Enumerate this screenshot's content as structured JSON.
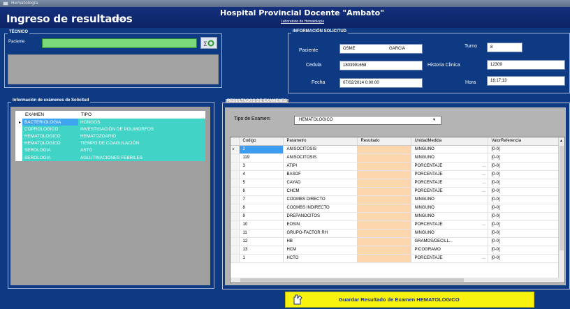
{
  "window": {
    "title": "Hematología"
  },
  "header": {
    "app_title": "Ingreso de resultados",
    "app_subtitle": "Iflat 2",
    "hospital": "Hospital Provincial Docente \"Ambato\"",
    "hospital_subtitle": "Laboratorio de Hematología"
  },
  "tecnico": {
    "title": "TÉCNICO",
    "paciente_label": "Paciente"
  },
  "solicitud": {
    "title": "INFORMACIÓN SOLICITUD",
    "paciente_label": "Paciente",
    "nombre": "OSME",
    "apellido": "GARCIA",
    "turno_label": "Turno",
    "turno": "8",
    "cedula_label": "Cedula",
    "cedula": "1803991658",
    "historia_label": "Historia Clinica",
    "historia": "12309",
    "fecha_label": "Fecha",
    "fecha": "07/02/2014 0:00:00",
    "hora_label": "Hora",
    "hora": "16:17:13"
  },
  "examenes": {
    "title": "Información de exámenes de Solicitud",
    "columns": [
      "EXAMEN",
      "TIPO"
    ],
    "rows": [
      {
        "examen": "BACTERIOLOGIA",
        "tipo": "HONGOS"
      },
      {
        "examen": "COPROLOGICO",
        "tipo": "INVESTIGACIÓN DE POLIMORFOS"
      },
      {
        "examen": "HEMATOLOGICO",
        "tipo": "HEMATOZOARIO"
      },
      {
        "examen": "HEMATOLOGICO",
        "tipo": "TIEMPO DE COAGULACIÓN"
      },
      {
        "examen": "SEROLOGIA",
        "tipo": "ASTO"
      },
      {
        "examen": "SEROLOGIA",
        "tipo": "AGLUTINACIONES FEBRILES"
      }
    ]
  },
  "resultados": {
    "title": "RESULTADOS DE EXAMENES",
    "tipo_label": "Tipo de Examen:",
    "tipo_value": "HEMATOLOGICO",
    "columns": [
      "Codigo",
      "Parametro",
      "Resultado",
      "UnidadMedida",
      "ValorReferencia"
    ],
    "rows": [
      {
        "codigo": "2",
        "parametro": "ANISOCITOSIS",
        "resultado": "",
        "unidad": "NINGUNO",
        "referencia": "[0-0]"
      },
      {
        "codigo": "119",
        "parametro": "ANISOCITOSIS",
        "resultado": "",
        "unidad": "NINGUNO",
        "referencia": "[0-0]"
      },
      {
        "codigo": "3",
        "parametro": "ATIPI",
        "resultado": "",
        "unidad": "PORCENTAJE",
        "referencia": "[0-0]"
      },
      {
        "codigo": "4",
        "parametro": "BASOF",
        "resultado": "",
        "unidad": "PORCENTAJE",
        "referencia": "[0-0]"
      },
      {
        "codigo": "5",
        "parametro": "CAYAD",
        "resultado": "",
        "unidad": "PORCENTAJE",
        "referencia": "[0-0]"
      },
      {
        "codigo": "6",
        "parametro": "CHCM",
        "resultado": "",
        "unidad": "PORCENTAJE",
        "referencia": "[0-0]"
      },
      {
        "codigo": "7",
        "parametro": "COOMBS DIRECTO",
        "resultado": "",
        "unidad": "NINGUNO",
        "referencia": "[0-0]"
      },
      {
        "codigo": "8",
        "parametro": "COOMBS INDIRECTO",
        "resultado": "",
        "unidad": "NINGUNO",
        "referencia": "[0-0]"
      },
      {
        "codigo": "9",
        "parametro": "DREPANOCITOS",
        "resultado": "",
        "unidad": "NINGUNO",
        "referencia": "[0-0]"
      },
      {
        "codigo": "10",
        "parametro": "EOSIN",
        "resultado": "",
        "unidad": "PORCENTAJE",
        "referencia": "[0-0]"
      },
      {
        "codigo": "11",
        "parametro": "GRUPO-FACTOR RH",
        "resultado": "",
        "unidad": "NINGUNO",
        "referencia": "[0-0]"
      },
      {
        "codigo": "12",
        "parametro": "HB",
        "resultado": "",
        "unidad": "GRAMOS/DECILL...",
        "referencia": "[0-0]"
      },
      {
        "codigo": "13",
        "parametro": "HCM",
        "resultado": "",
        "unidad": "PICOGRAMO",
        "referencia": "[0-0]"
      },
      {
        "codigo": "1",
        "parametro": "HCTO",
        "resultado": "",
        "unidad": "PORCENTAJE",
        "referencia": "[0-0]"
      }
    ]
  },
  "save_button": {
    "label": "Guardar Resultado de Examen HEMATOLOGICO"
  },
  "colors": {
    "background": "#0d3a82",
    "exam_row": "#41d3c6",
    "selected_cell": "#3b9cf0",
    "result_cell": "#fcd7ae",
    "save_button": "#f7f20e"
  }
}
